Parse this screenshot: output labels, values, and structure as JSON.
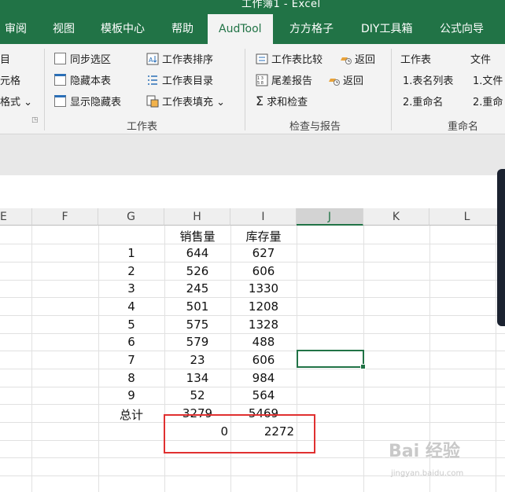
{
  "title": "工作簿1 - Excel",
  "tabs": [
    "审阅",
    "视图",
    "模板中心",
    "帮助",
    "AudTool",
    "方方格子",
    "DIY工具箱",
    "公式向导"
  ],
  "active_tab": "AudTool",
  "ribbon": {
    "left_partial": [
      "目",
      "元格",
      "格式 ⌄"
    ],
    "sheet_group": {
      "items": [
        "同步选区",
        "隐藏本表",
        "显示隐藏表",
        "工作表排序",
        "工作表目录",
        "工作表填充 ⌄"
      ],
      "label": "工作表"
    },
    "check_group": {
      "items": [
        "工作表比较",
        "尾差报告",
        "求和检查"
      ],
      "back": [
        "返回",
        "返回"
      ],
      "label": "检查与报告"
    },
    "rename_group": {
      "items": [
        "工作表",
        "1.表名列表",
        "2.重命名",
        "文件",
        "1.文件",
        "2.重命"
      ],
      "label": "重命名"
    }
  },
  "columns": [
    "E",
    "F",
    "G",
    "H",
    "I",
    "J",
    "K",
    "L"
  ],
  "headers": {
    "h": "销售量",
    "i": "库存量"
  },
  "rows": [
    {
      "g": "1",
      "h": "644",
      "i": "627"
    },
    {
      "g": "2",
      "h": "526",
      "i": "606"
    },
    {
      "g": "3",
      "h": "245",
      "i": "1330"
    },
    {
      "g": "4",
      "h": "501",
      "i": "1208"
    },
    {
      "g": "5",
      "h": "575",
      "i": "1328"
    },
    {
      "g": "6",
      "h": "579",
      "i": "488"
    },
    {
      "g": "7",
      "h": "23",
      "i": "606"
    },
    {
      "g": "8",
      "h": "134",
      "i": "984"
    },
    {
      "g": "9",
      "h": "52",
      "i": "564"
    }
  ],
  "total": {
    "label": "总计",
    "h": "3279",
    "i": "5469"
  },
  "result": {
    "h": "0",
    "i": "2272"
  },
  "watermark": {
    "brand": "Bai 经验",
    "url": "jingyan.baidu.com"
  },
  "colors": {
    "excel_green": "#217346",
    "highlight_red": "#e03030"
  }
}
